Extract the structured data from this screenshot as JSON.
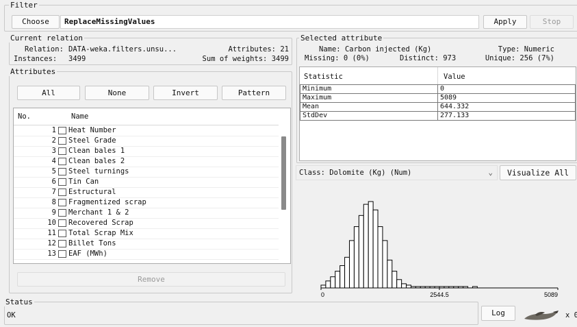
{
  "filter": {
    "legend": "Filter",
    "choose_label": "Choose",
    "filter_name": "ReplaceMissingValues",
    "apply_label": "Apply",
    "stop_label": "Stop"
  },
  "relation": {
    "legend": "Current relation",
    "relation_label": "Relation:",
    "relation_value": "DATA-weka.filters.unsu...",
    "attributes_label": "Attributes:",
    "attributes_value": "21",
    "instances_label": "Instances:",
    "instances_value": "3499",
    "weights_label": "Sum of weights:",
    "weights_value": "3499"
  },
  "attributes": {
    "legend": "Attributes",
    "buttons": {
      "all": "All",
      "none": "None",
      "invert": "Invert",
      "pattern": "Pattern"
    },
    "col_no": "No.",
    "col_name": "Name",
    "items": [
      {
        "no": "1",
        "name": "Heat Number"
      },
      {
        "no": "2",
        "name": "Steel Grade"
      },
      {
        "no": "3",
        "name": "Clean bales 1"
      },
      {
        "no": "4",
        "name": "Clean bales 2"
      },
      {
        "no": "5",
        "name": "Steel turnings"
      },
      {
        "no": "6",
        "name": "Tin Can"
      },
      {
        "no": "7",
        "name": "Estructural"
      },
      {
        "no": "8",
        "name": "Fragmentized scrap"
      },
      {
        "no": "9",
        "name": "Merchant 1 & 2"
      },
      {
        "no": "10",
        "name": "Recovered Scrap"
      },
      {
        "no": "11",
        "name": "Total Scrap Mix"
      },
      {
        "no": "12",
        "name": "Billet Tons"
      },
      {
        "no": "13",
        "name": "EAF (MWh)"
      }
    ],
    "remove_label": "Remove"
  },
  "selected": {
    "legend": "Selected attribute",
    "name_label": "Name:",
    "name_value": "Carbon injected (Kg)",
    "type_label": "Type:",
    "type_value": "Numeric",
    "missing_label": "Missing:",
    "missing_value": "0 (0%)",
    "distinct_label": "Distinct:",
    "distinct_value": "973",
    "unique_label": "Unique:",
    "unique_value": "256 (7%)",
    "col_statistic": "Statistic",
    "col_value": "Value",
    "stats": [
      {
        "name": "Minimum",
        "value": "0"
      },
      {
        "name": "Maximum",
        "value": "5089"
      },
      {
        "name": "Mean",
        "value": "644.332"
      },
      {
        "name": "StdDev",
        "value": "277.133"
      }
    ]
  },
  "class_selector": {
    "label": "Class: Dolomite (Kg) (Num)",
    "visualize_label": "Visualize All"
  },
  "chart_data": {
    "type": "bar",
    "title": "",
    "xlabel": "",
    "ylabel": "",
    "x_tick_labels": [
      "0",
      "2544.5",
      "5089"
    ],
    "xlim": [
      0,
      5089
    ],
    "bin_width": 101.78,
    "values": [
      2,
      5,
      8,
      12,
      16,
      22,
      34,
      44,
      52,
      60,
      62,
      56,
      44,
      34,
      20,
      12,
      6,
      3,
      2,
      1,
      1,
      1,
      1,
      1,
      1,
      1,
      1,
      1,
      1,
      1,
      1,
      0,
      1,
      0,
      0,
      0,
      0,
      0,
      0,
      0,
      0,
      0,
      0,
      0,
      0,
      0,
      0,
      0,
      0,
      0
    ],
    "bar_color": "#ffffff",
    "outline_color": "#000000"
  },
  "status": {
    "legend": "Status",
    "text": "OK",
    "log_label": "Log",
    "tasks_label": "x 0"
  }
}
